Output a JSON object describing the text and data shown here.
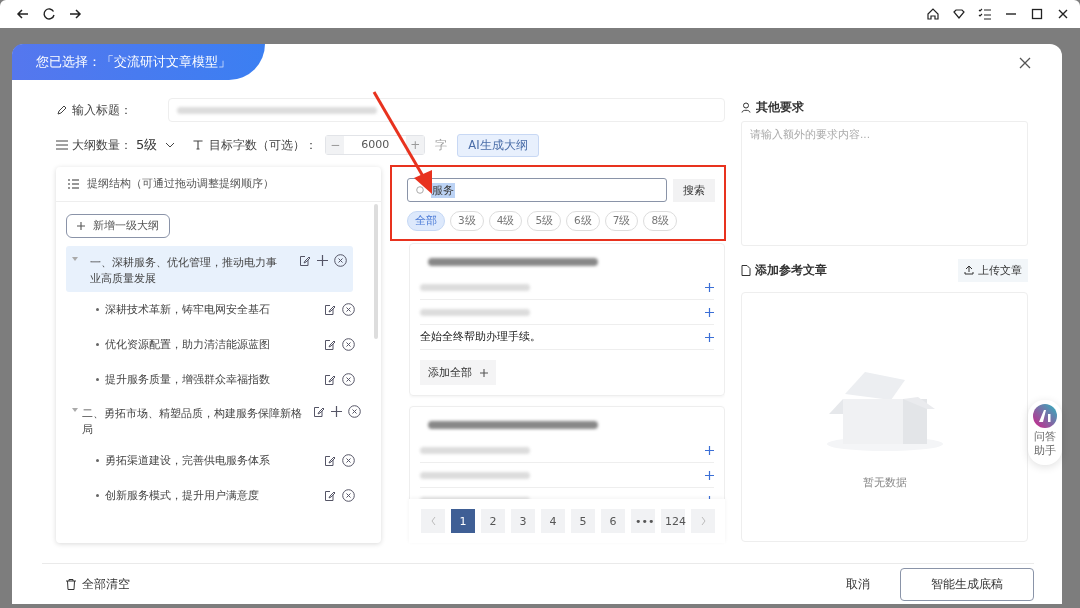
{
  "dialog": {
    "badge": "您已选择：「交流研讨文章模型」"
  },
  "title_field": {
    "label": "输入标题：",
    "value_redacted": true
  },
  "outline_count": {
    "label": "大纲数量：",
    "value": "5级"
  },
  "word_count": {
    "label": "目标字数（可选）：",
    "minus": "−",
    "value": "6000",
    "plus": "+",
    "unit": "字"
  },
  "generate_outline_button": "AI生成大纲",
  "outline_panel": {
    "title": "提纲结构（可通过拖动调整提纲顺序）",
    "add_button": "新增一级大纲",
    "items": [
      {
        "text": "一、深耕服务、优化管理，推动电力事业高质量发展",
        "selected": true,
        "expanded": true,
        "children": [
          {
            "text": "深耕技术革新，铸牢电网安全基石"
          },
          {
            "text": "优化资源配置，助力清洁能源蓝图"
          },
          {
            "text": "提升服务质量，增强群众幸福指数"
          }
        ]
      },
      {
        "text": "二、勇拓市场、精塑品质，构建服务保障新格局",
        "selected": false,
        "expanded": true,
        "children": [
          {
            "text": "勇拓渠道建设，完善供电服务体系"
          },
          {
            "text": "创新服务模式，提升用户满意度"
          }
        ]
      }
    ]
  },
  "search": {
    "value": "服务",
    "button": "搜索",
    "chips": [
      {
        "label": "全部",
        "selected": true
      },
      {
        "label": "3级",
        "selected": false
      },
      {
        "label": "4级",
        "selected": false
      },
      {
        "label": "5级",
        "selected": false
      },
      {
        "label": "6级",
        "selected": false
      },
      {
        "label": "7级",
        "selected": false
      },
      {
        "label": "8级",
        "selected": false
      }
    ]
  },
  "results": [
    {
      "heading_redacted": true,
      "items": [
        {
          "kind": "redacted"
        },
        {
          "kind": "redacted"
        },
        {
          "kind": "text",
          "text": "全始全终帮助办理手续。"
        }
      ],
      "add_all": "添加全部"
    },
    {
      "heading_redacted": true,
      "items": [
        {
          "kind": "redacted"
        },
        {
          "kind": "redacted"
        },
        {
          "kind": "redacted"
        }
      ]
    }
  ],
  "pagination": [
    {
      "label": "1",
      "selected": true
    },
    {
      "label": "2",
      "selected": false
    },
    {
      "label": "3",
      "selected": false
    },
    {
      "label": "4",
      "selected": false
    },
    {
      "label": "5",
      "selected": false
    },
    {
      "label": "6",
      "selected": false
    },
    {
      "label": "•••",
      "selected": false
    },
    {
      "label": "124",
      "selected": false
    }
  ],
  "requirements": {
    "title": "其他要求",
    "placeholder": "请输入额外的要求内容..."
  },
  "references": {
    "title": "添加参考文章",
    "upload_button": "上传文章",
    "empty_text": "暂无数据"
  },
  "assistant": {
    "label": "问答助手"
  },
  "footer": {
    "clear_button": "全部清空",
    "cancel_button": "取消",
    "submit_button": "智能生成底稿"
  }
}
